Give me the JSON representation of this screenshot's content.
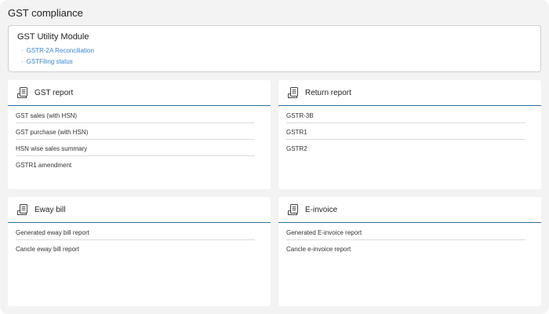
{
  "page": {
    "title": "GST compliance"
  },
  "utility": {
    "title": "GST Utility Module",
    "links": [
      "GSTR-2A Reconciliation",
      "GSTFiling status"
    ]
  },
  "cards": [
    {
      "title": "GST report",
      "icon": "report-icon",
      "items": [
        "GST sales (with HSN)",
        "GST purchase (with HSN)",
        "HSN wise sales summary",
        "GSTR1 amendment"
      ]
    },
    {
      "title": "Return report",
      "icon": "report-icon",
      "items": [
        "GSTR-3B",
        "GSTR1",
        "GSTR2"
      ]
    },
    {
      "title": "Eway bill",
      "icon": "report-icon",
      "items": [
        "Generated eway bill report",
        "Cancle eway bill report"
      ]
    },
    {
      "title": "E-invoice",
      "icon": "report-icon",
      "items": [
        "Generated E-invoice report",
        "Cancle e-invoice report"
      ]
    }
  ],
  "colors": {
    "accent": "#2f6f97",
    "link": "#3a86c8",
    "background": "#f3f3f3"
  }
}
